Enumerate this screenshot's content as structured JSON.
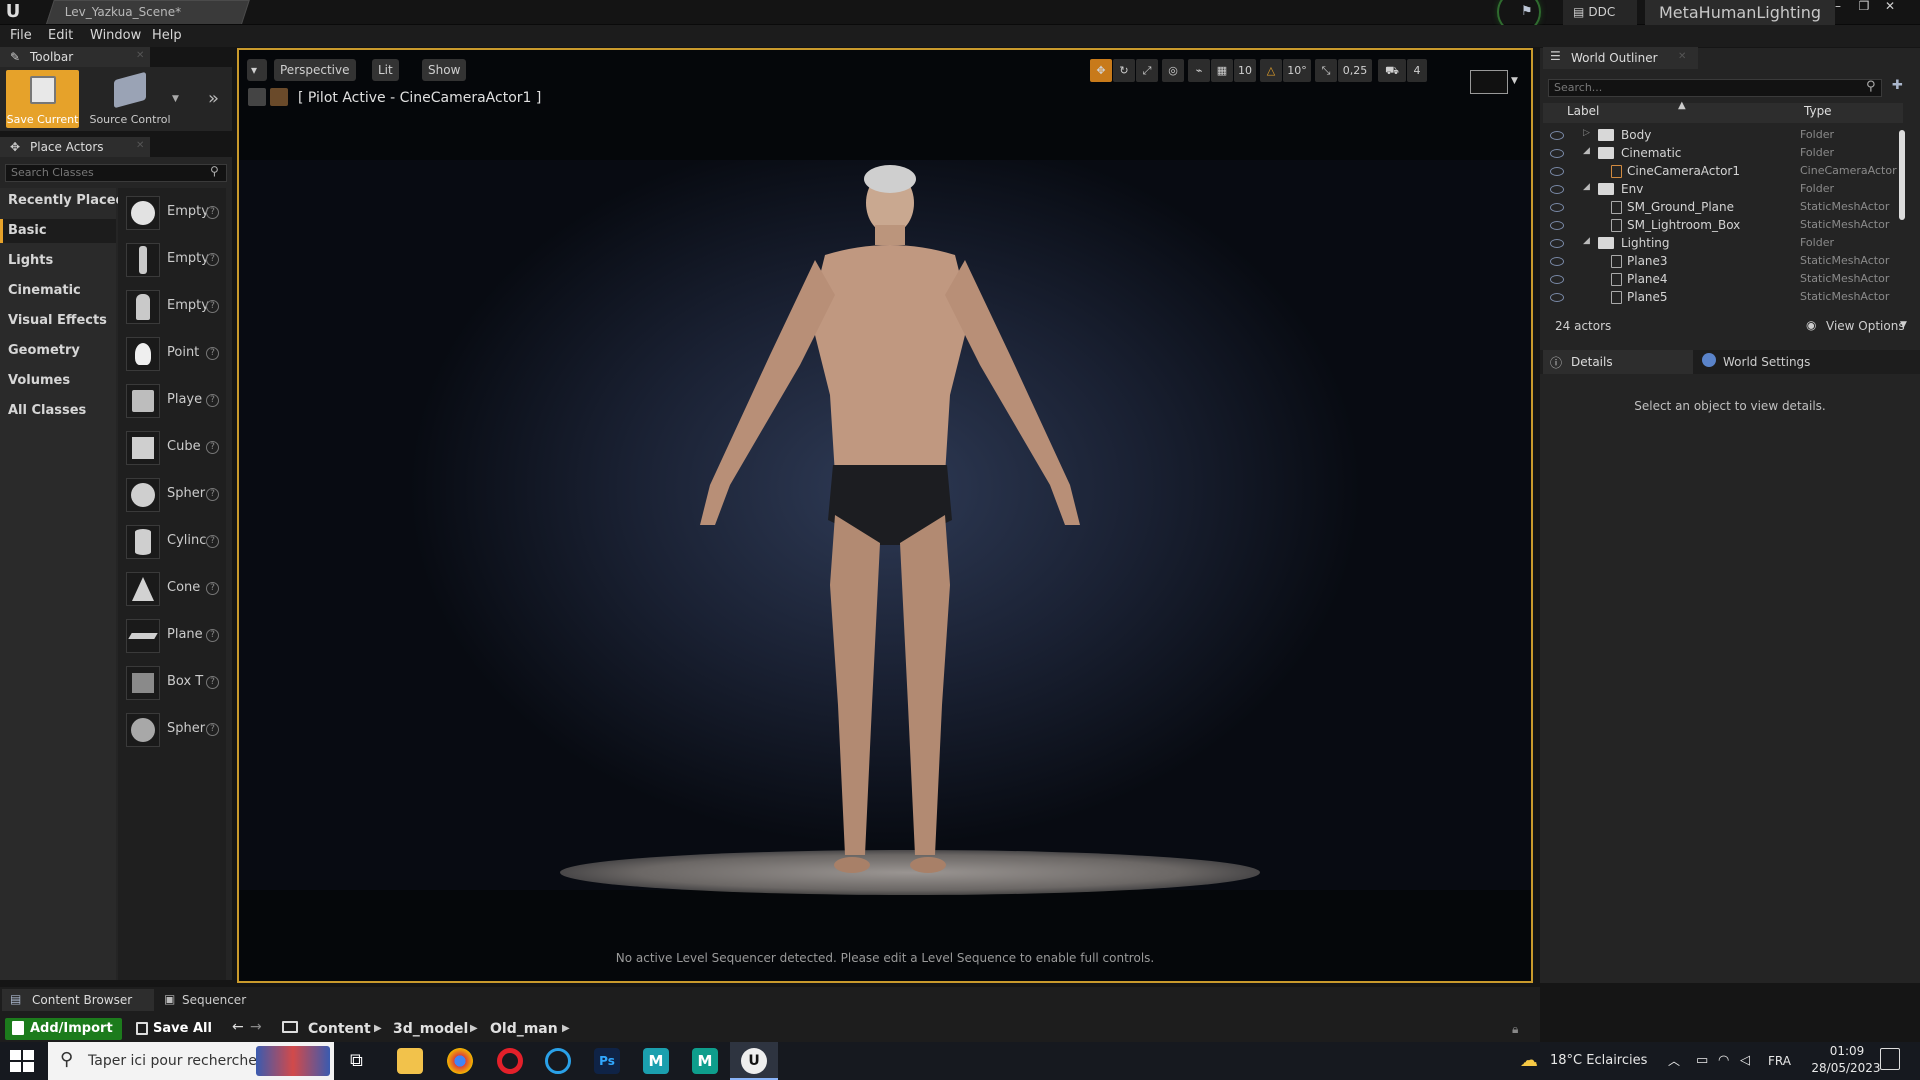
{
  "window": {
    "doc_tab": "Lev_Yazkua_Scene*",
    "ddc_label": "DDC",
    "project_name": "MetaHumanLighting"
  },
  "menu": [
    "File",
    "Edit",
    "Window",
    "Help"
  ],
  "toolbar": {
    "tab_label": "Toolbar",
    "save_current": "Save Current",
    "source_control": "Source Control"
  },
  "place_actors": {
    "tab_label": "Place Actors",
    "search_placeholder": "Search Classes",
    "categories": [
      "Recently Placed",
      "Basic",
      "Lights",
      "Cinematic",
      "Visual Effects",
      "Geometry",
      "Volumes",
      "All Classes"
    ],
    "selected_category": "Basic",
    "actors": [
      "Empty",
      "Empty",
      "Empty",
      "Point",
      "Playe",
      "Cube",
      "Spher",
      "Cylinc",
      "Cone",
      "Plane",
      "Box T",
      "Spher"
    ]
  },
  "viewport": {
    "perspective_label": "Perspective",
    "lit_label": "Lit",
    "show_label": "Show",
    "pilot_label": "[ Pilot Active - CineCameraActor1 ]",
    "grid_snap": "10",
    "rotation_snap": "10°",
    "scale_snap": "0,25",
    "camera_speed": "4",
    "sequencer_message": "No active Level Sequencer detected. Please edit a Level Sequence to enable full controls."
  },
  "outliner": {
    "tab_label": "World Outliner",
    "search_placeholder": "Search...",
    "col_label": "Label",
    "col_type": "Type",
    "rows": [
      {
        "label": "Body",
        "type": "Folder"
      },
      {
        "label": "Cinematic",
        "type": "Folder"
      },
      {
        "label": "CineCameraActor1",
        "type": "CineCameraActor"
      },
      {
        "label": "Env",
        "type": "Folder"
      },
      {
        "label": "SM_Ground_Plane",
        "type": "StaticMeshActor"
      },
      {
        "label": "SM_Lightroom_Box",
        "type": "StaticMeshActor"
      },
      {
        "label": "Lighting",
        "type": "Folder"
      },
      {
        "label": "Plane3",
        "type": "StaticMeshActor"
      },
      {
        "label": "Plane4",
        "type": "StaticMeshActor"
      },
      {
        "label": "Plane5",
        "type": "StaticMeshActor"
      }
    ],
    "actor_count": "24 actors",
    "view_options": "View Options"
  },
  "details": {
    "tab_label": "Details",
    "world_settings_label": "World Settings",
    "empty_message": "Select an object to view details."
  },
  "content_browser": {
    "tab_label": "Content Browser",
    "sequencer_tab": "Sequencer",
    "add_import": "Add/Import",
    "save_all": "Save All",
    "breadcrumbs": [
      "Content",
      "3d_model",
      "Old_man"
    ]
  },
  "taskbar": {
    "search_placeholder": "Taper ici pour rechercher",
    "weather": "18°C  Eclaircies",
    "language": "FRA",
    "time": "01:09",
    "date": "28/05/2023"
  },
  "colors": {
    "accent": "#e6a22a",
    "add_import_green": "#1c7b1c",
    "viewport_border": "#c99a2c"
  }
}
